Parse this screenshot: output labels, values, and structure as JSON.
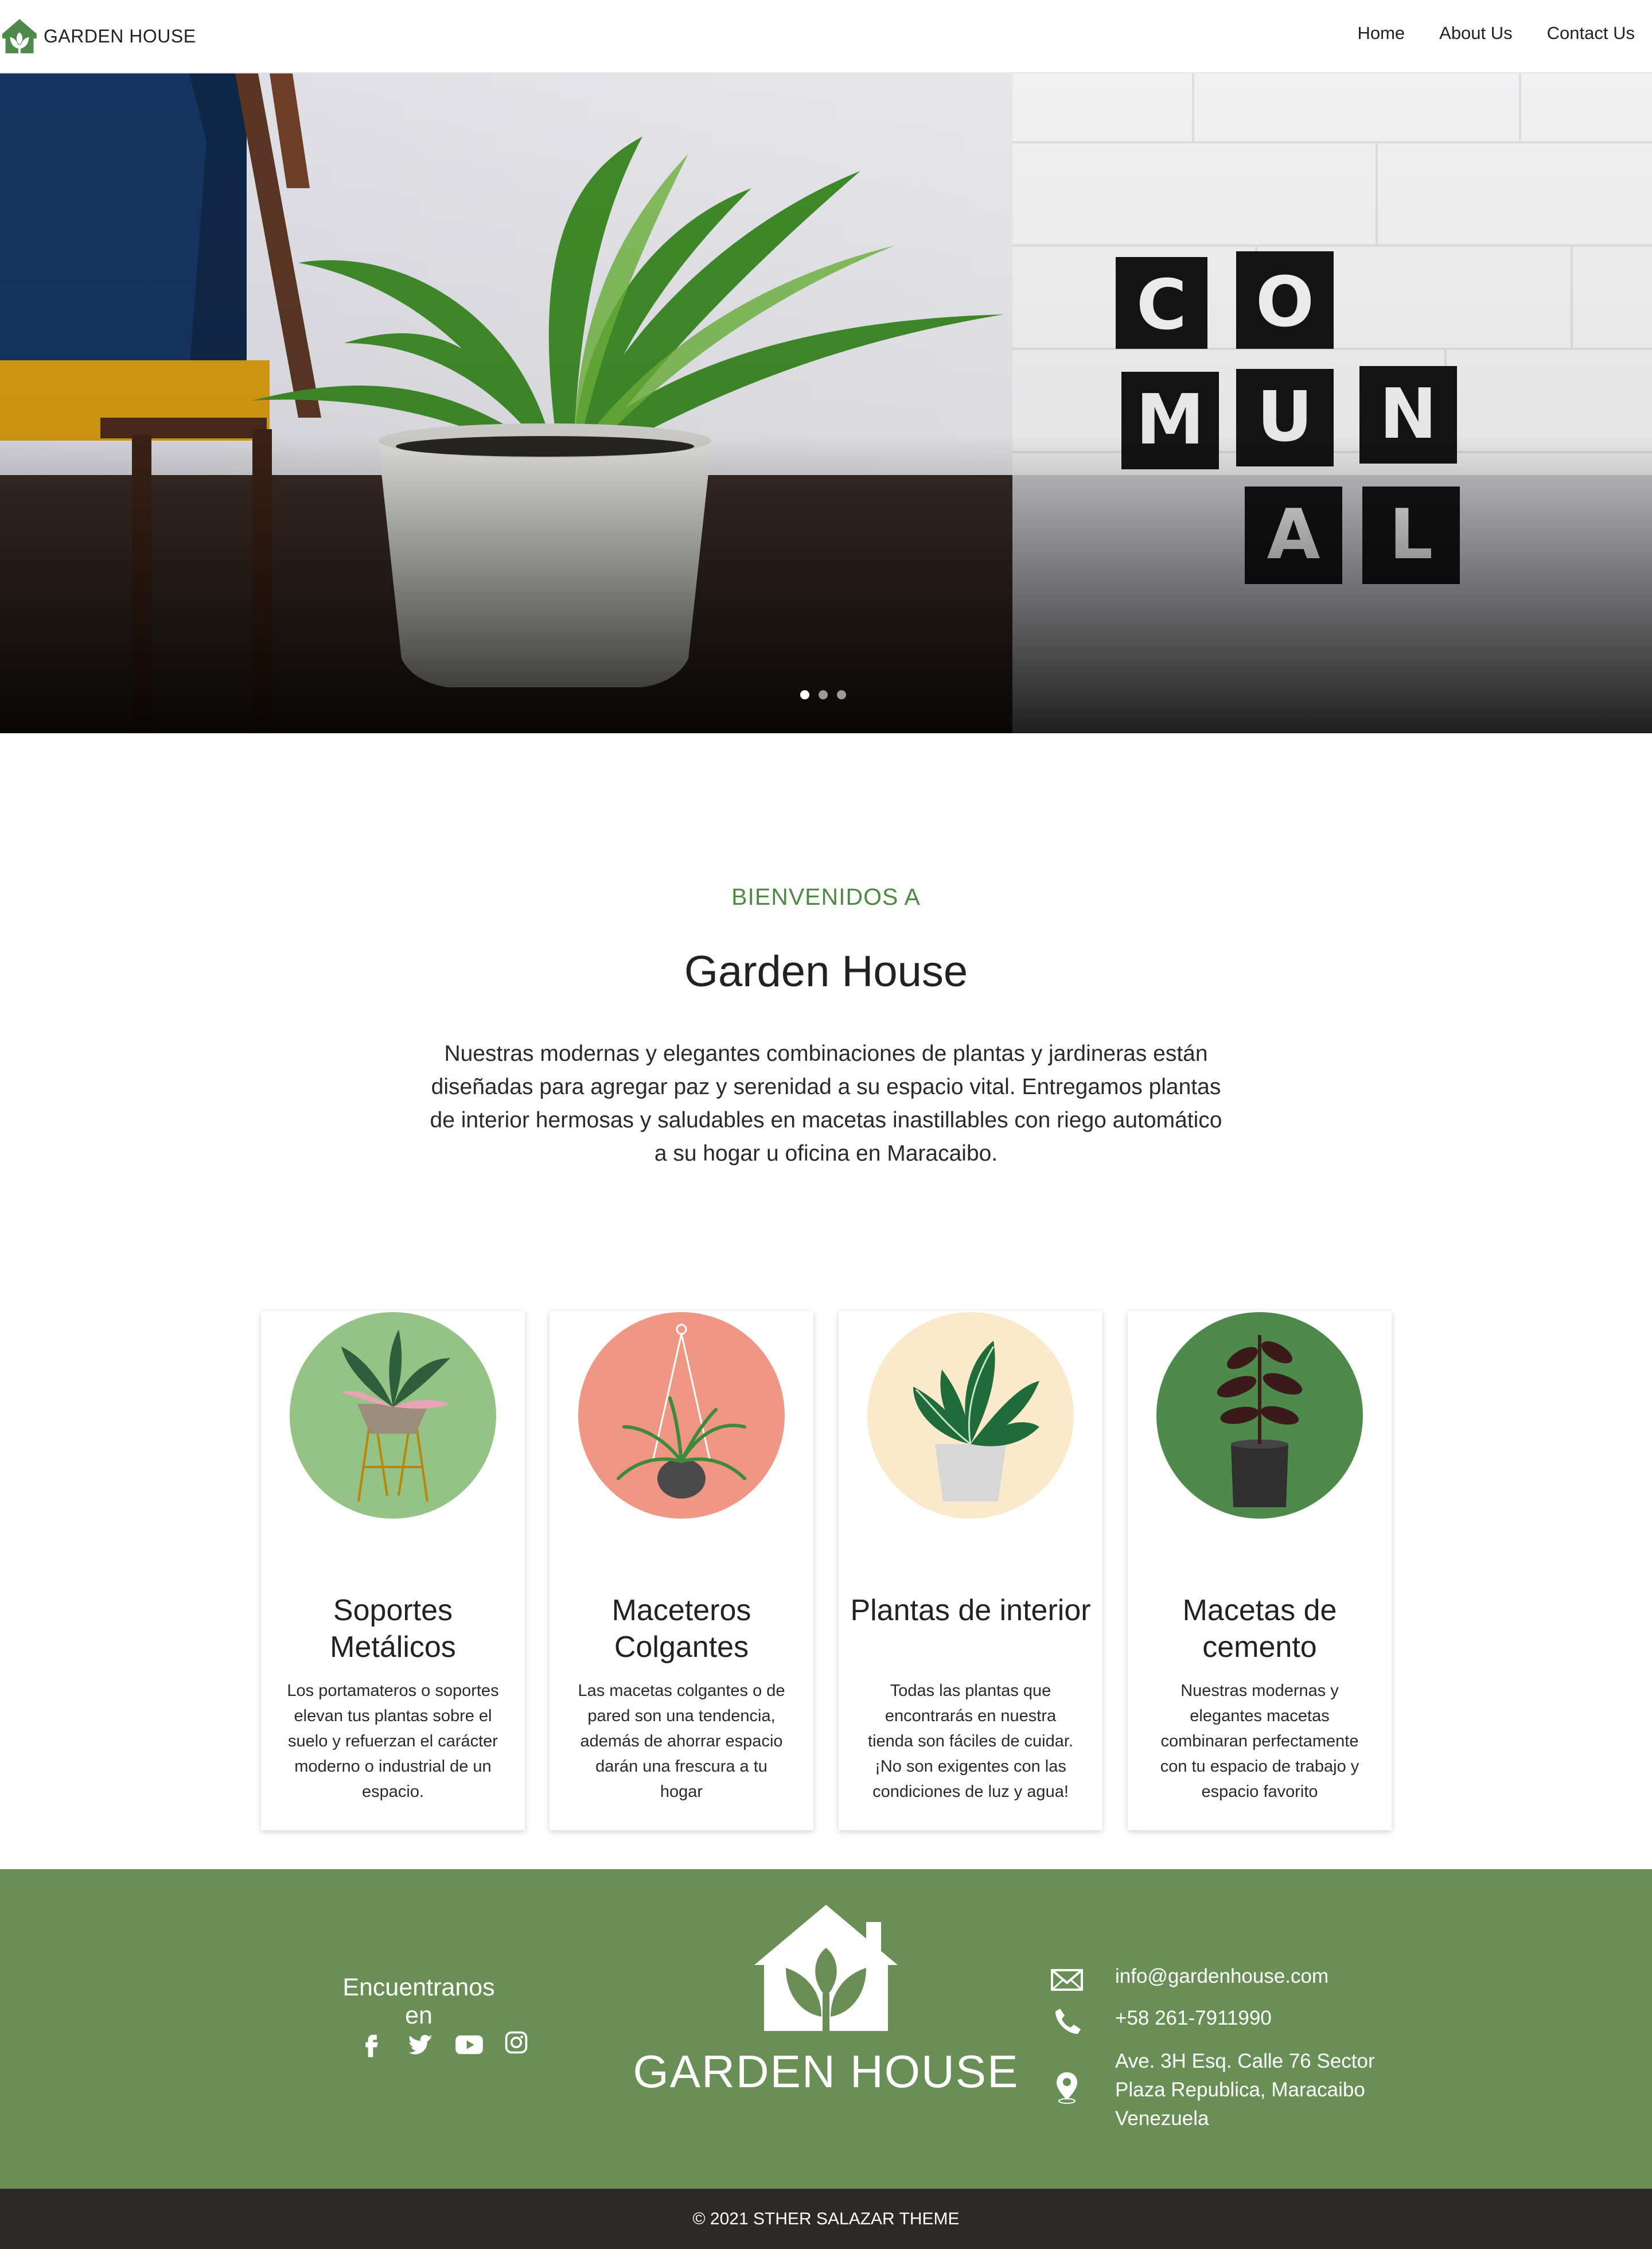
{
  "nav": {
    "brand": "GARDEN HOUSE",
    "links": [
      "Home",
      "About Us",
      "Contact Us"
    ]
  },
  "hero": {
    "sign_letters": [
      "C",
      "O",
      "M",
      "U",
      "N",
      "A",
      "L"
    ],
    "slide_count": 3,
    "active_slide": 1
  },
  "welcome": {
    "eyebrow": "BIENVENIDOS A",
    "title": "Garden House",
    "body": "Nuestras modernas y elegantes combinaciones de plantas y jardineras están diseñadas para agregar paz y serenidad a su espacio vital. Entregamos plantas de interior hermosas y saludables en macetas inastillables con riego automático a su hogar u oficina en Maracaibo."
  },
  "cards": [
    {
      "title": "Soportes Metálicos",
      "desc": "Los portamateros o soportes elevan tus plantas sobre el suelo y refuerzan el carácter moderno o industrial de un espacio.",
      "circle_color": "#94c385"
    },
    {
      "title": "Maceteros Colgantes",
      "desc": "Las macetas colgantes o de pared son una tendencia, además de ahorrar espacio darán una frescura a tu hogar",
      "circle_color": "#ef9684"
    },
    {
      "title": "Plantas de interior",
      "desc": "Todas las plantas que encontrarás en nuestra tienda son fáciles de cuidar. ¡No son exigentes con las condiciones de luz y agua!",
      "circle_color": "#fbe9cb"
    },
    {
      "title": "Macetas de cemento",
      "desc": "Nuestras modernas y elegantes macetas combinaran perfectamente con tu espacio de trabajo y espacio favorito",
      "circle_color": "#4e8a4b"
    }
  ],
  "footer": {
    "find_us": "Encuentranos en",
    "social_icons": [
      "facebook-icon",
      "twitter-icon",
      "youtube-icon",
      "instagram-icon"
    ],
    "brand": "GARDEN HOUSE",
    "email": "info@gardenhouse.com",
    "phone": "+58 261-7911990",
    "address": [
      "Ave. 3H Esq. Calle 76 Sector",
      "Plaza Republica, Maracaibo",
      "Venezuela"
    ],
    "copyright": "© 2021 STHER SALAZAR THEME"
  },
  "colors": {
    "accent_green": "#4f8a45",
    "footer_green": "#698f57",
    "bottom_bar": "#2b2a27"
  }
}
